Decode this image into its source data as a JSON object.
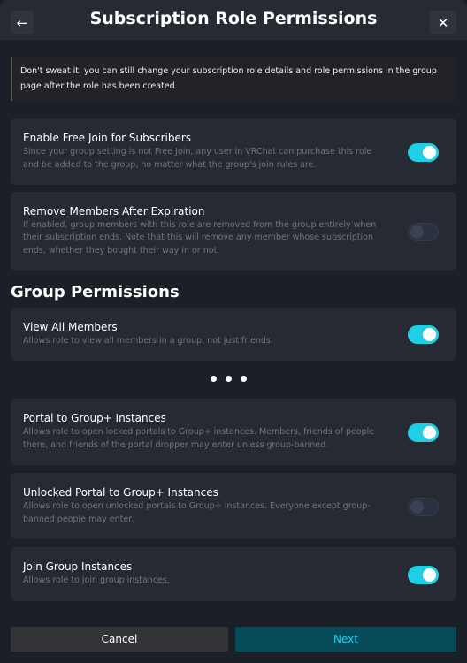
{
  "header": {
    "title": "Subscription Role Permissions",
    "back_icon": "arrow-left-icon",
    "close_icon": "close-icon"
  },
  "notice": "Don't sweat it, you can still change your subscription role details and role permissions in the group page after the role has been created.",
  "settings": [
    {
      "title": "Enable Free Join for Subscribers",
      "desc": "Since your group setting is not Free Join, any user in VRChat can purchase this role and be added to the group, no matter what the group's join rules are.",
      "enabled": true
    },
    {
      "title": "Remove Members After Expiration",
      "desc": "If enabled, group members with this role are removed from the group entirely when their subscription ends. Note that this will remove any member whose subscription ends, whether they bought their way in or not.",
      "enabled": false
    }
  ],
  "group_permissions": {
    "heading": "Group Permissions",
    "items": [
      {
        "title": "View All Members",
        "desc": "Allows role to view all members in a group, not just friends.",
        "enabled": true
      },
      {
        "title": "Portal to Group+ Instances",
        "desc": "Allows role to open locked portals to Group+ instances. Members, friends of people there, and friends of the portal dropper may enter unless group-banned.",
        "enabled": true
      },
      {
        "title": "Unlocked Portal to Group+ Instances",
        "desc": "Allows role to open unlocked portals to Group+ instances. Everyone except group-banned people may enter.",
        "enabled": false
      },
      {
        "title": "Join Group Instances",
        "desc": "Allows role to join group instances.",
        "enabled": true
      }
    ]
  },
  "footer": {
    "cancel": "Cancel",
    "next": "Next"
  },
  "colors": {
    "accent": "#1ed0e6",
    "next_bg": "#074a5a",
    "next_text": "#1ed0e6"
  }
}
